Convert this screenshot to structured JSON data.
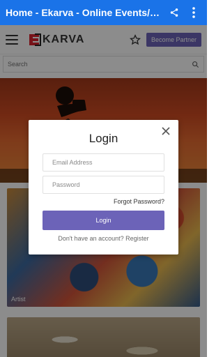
{
  "appbar": {
    "title": "Home - Ekarva - Online Events/Ar...",
    "share_icon": "share-icon",
    "more_icon": "more-vert-icon",
    "color": "#1a73e8"
  },
  "header": {
    "logo_text": "KARVA",
    "menu_icon": "hamburger-icon",
    "star_icon": "star-outline-icon",
    "partner_label": "Become Partner",
    "brand_color": "#6c63b8"
  },
  "search": {
    "placeholder": "Search",
    "icon": "search-icon"
  },
  "cards": [
    {
      "label": "Artist"
    },
    {
      "label": ""
    }
  ],
  "modal": {
    "title": "Login",
    "close_icon": "close-icon",
    "email_placeholder": "Email Address",
    "password_placeholder": "Password",
    "forgot_label": "Forgot Password?",
    "login_label": "Login",
    "register_prompt": "Don't have an account?",
    "register_label": "Register"
  }
}
